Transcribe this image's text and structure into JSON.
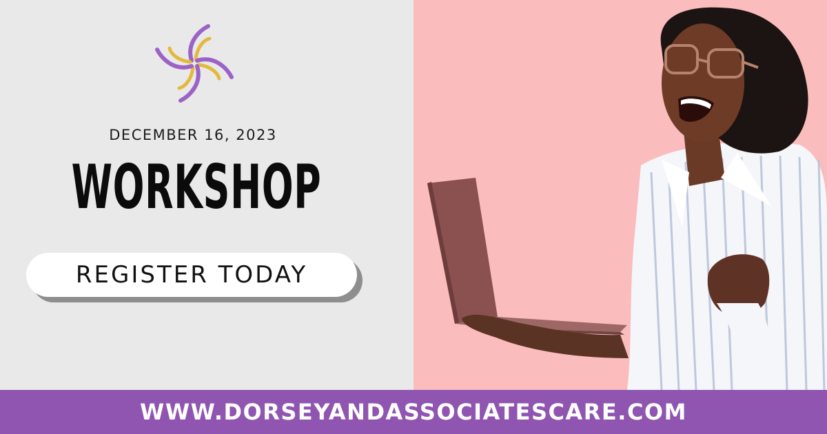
{
  "event": {
    "date": "DECEMBER 16, 2023",
    "title": "WORKSHOP",
    "cta_label": "REGISTER TODAY"
  },
  "footer": {
    "url": "WWW.DORSEYANDASSOCIATESCARE.COM"
  },
  "colors": {
    "left_background": "#e9e9ea",
    "right_background": "#fbbcbd",
    "footer_background": "#8f55b1",
    "logo_purple": "#9b63c6",
    "logo_gold": "#e3b93c"
  },
  "icons": {
    "logo": "pinwheel-logo-icon"
  },
  "image": {
    "subject": "smiling woman in glasses holding a laptop"
  }
}
